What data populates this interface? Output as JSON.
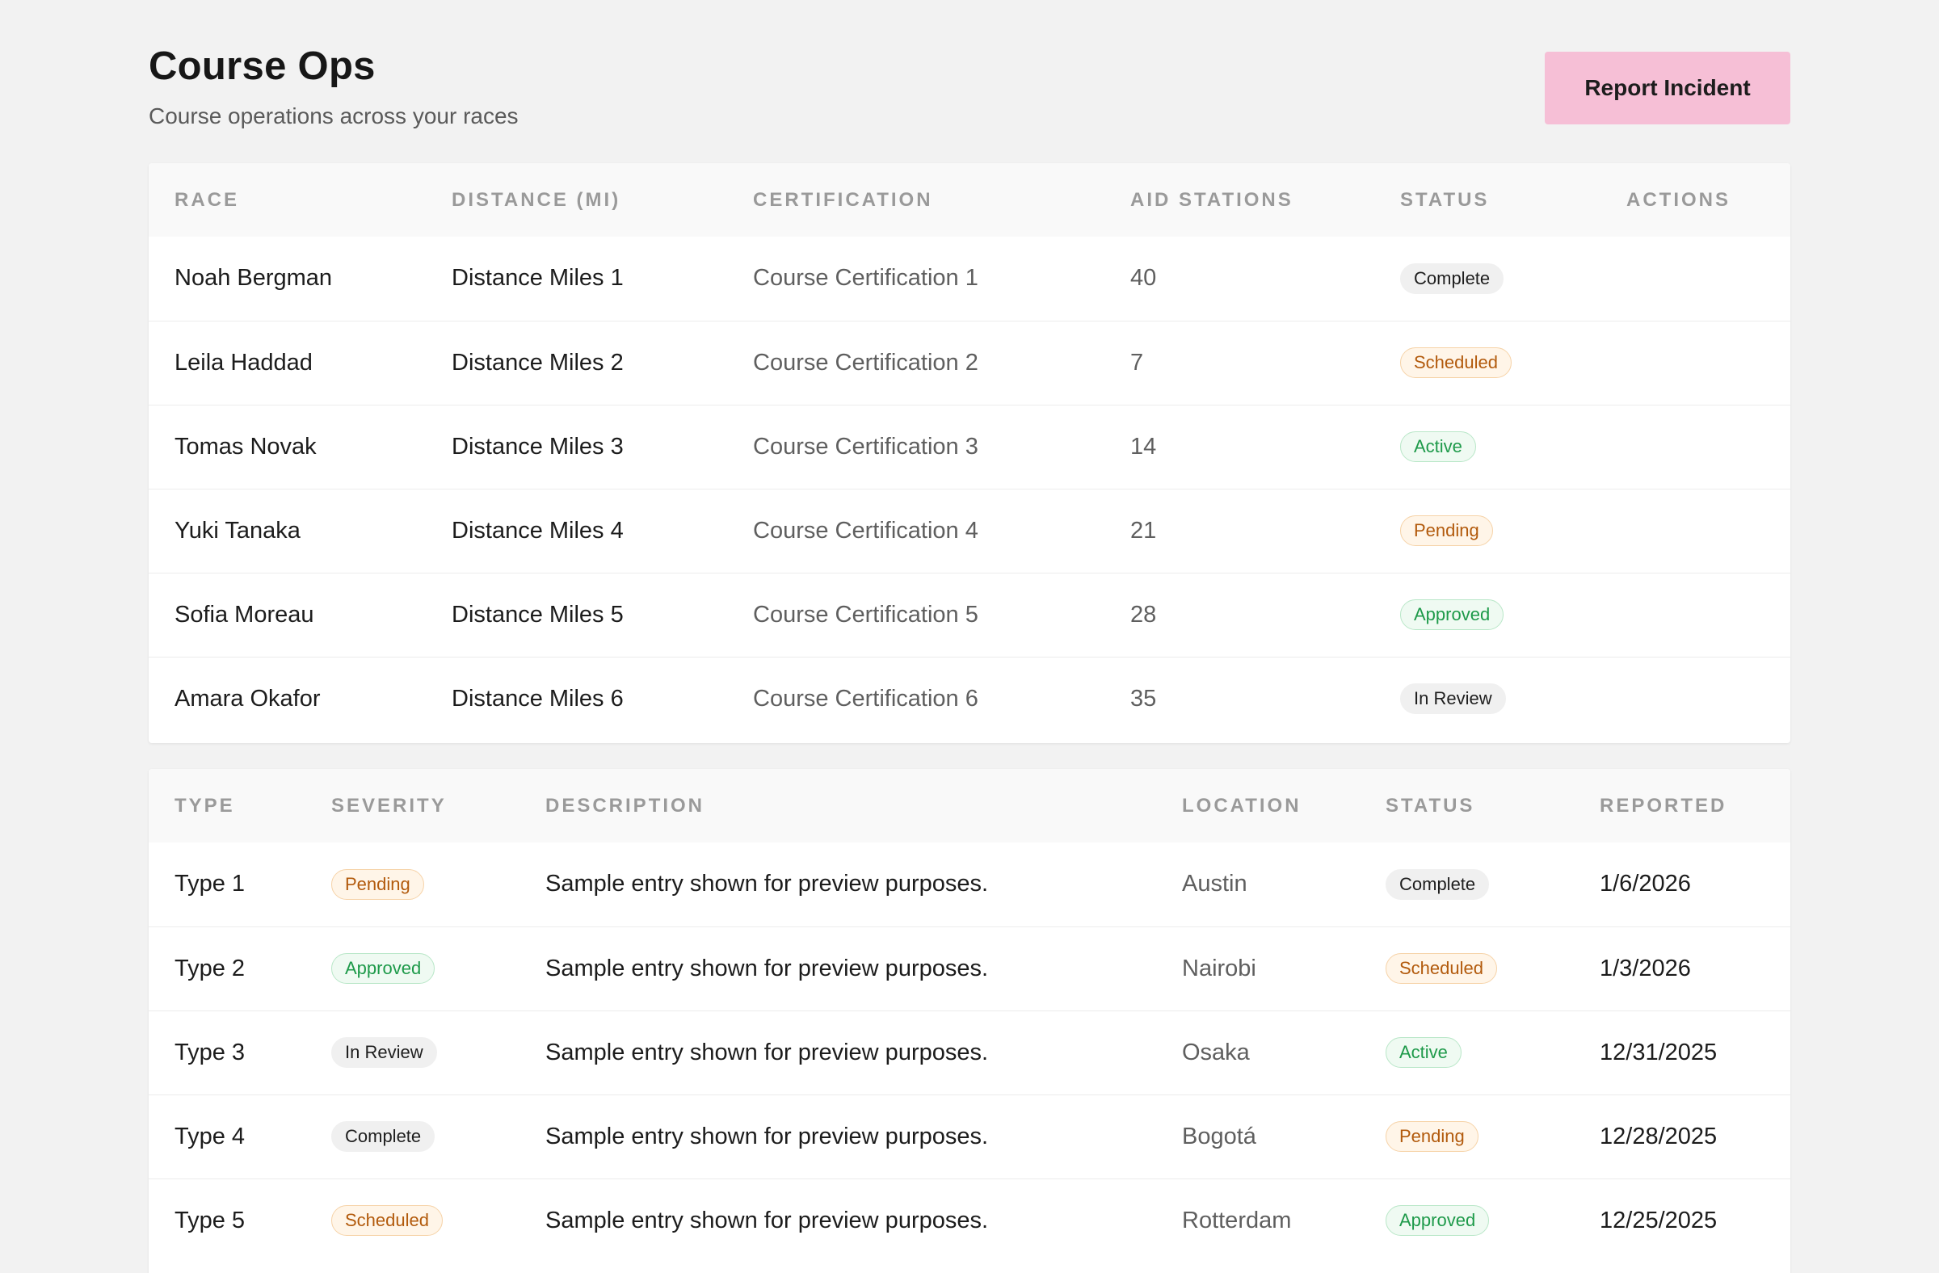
{
  "header": {
    "title": "Course Ops",
    "subtitle": "Course operations across your races",
    "report_button_label": "Report Incident"
  },
  "colors": {
    "background": "#f2f2f2",
    "accent_button": "#f6bfd6",
    "badge_neutral": "#f0f0f0",
    "badge_warning": "#b25a0c",
    "badge_success": "#1e9a4a"
  },
  "races_table": {
    "columns": [
      "RACE",
      "DISTANCE (MI)",
      "CERTIFICATION",
      "AID STATIONS",
      "STATUS",
      "ACTIONS"
    ],
    "rows": [
      {
        "race": "Noah Bergman",
        "distance": "Distance Miles 1",
        "certification": "Course Certification 1",
        "aid_stations": "40",
        "status": "Complete"
      },
      {
        "race": "Leila Haddad",
        "distance": "Distance Miles 2",
        "certification": "Course Certification 2",
        "aid_stations": "7",
        "status": "Scheduled"
      },
      {
        "race": "Tomas Novak",
        "distance": "Distance Miles 3",
        "certification": "Course Certification 3",
        "aid_stations": "14",
        "status": "Active"
      },
      {
        "race": "Yuki Tanaka",
        "distance": "Distance Miles 4",
        "certification": "Course Certification 4",
        "aid_stations": "21",
        "status": "Pending"
      },
      {
        "race": "Sofia Moreau",
        "distance": "Distance Miles 5",
        "certification": "Course Certification 5",
        "aid_stations": "28",
        "status": "Approved"
      },
      {
        "race": "Amara Okafor",
        "distance": "Distance Miles 6",
        "certification": "Course Certification 6",
        "aid_stations": "35",
        "status": "In Review"
      }
    ]
  },
  "incidents_table": {
    "columns": [
      "TYPE",
      "SEVERITY",
      "DESCRIPTION",
      "LOCATION",
      "STATUS",
      "REPORTED"
    ],
    "rows": [
      {
        "type": "Type 1",
        "severity": "Pending",
        "description": "Sample entry shown for preview purposes.",
        "location": "Austin",
        "status": "Complete",
        "reported": "1/6/2026"
      },
      {
        "type": "Type 2",
        "severity": "Approved",
        "description": "Sample entry shown for preview purposes.",
        "location": "Nairobi",
        "status": "Scheduled",
        "reported": "1/3/2026"
      },
      {
        "type": "Type 3",
        "severity": "In Review",
        "description": "Sample entry shown for preview purposes.",
        "location": "Osaka",
        "status": "Active",
        "reported": "12/31/2025"
      },
      {
        "type": "Type 4",
        "severity": "Complete",
        "description": "Sample entry shown for preview purposes.",
        "location": "Bogotá",
        "status": "Pending",
        "reported": "12/28/2025"
      },
      {
        "type": "Type 5",
        "severity": "Scheduled",
        "description": "Sample entry shown for preview purposes.",
        "location": "Rotterdam",
        "status": "Approved",
        "reported": "12/25/2025"
      }
    ]
  }
}
